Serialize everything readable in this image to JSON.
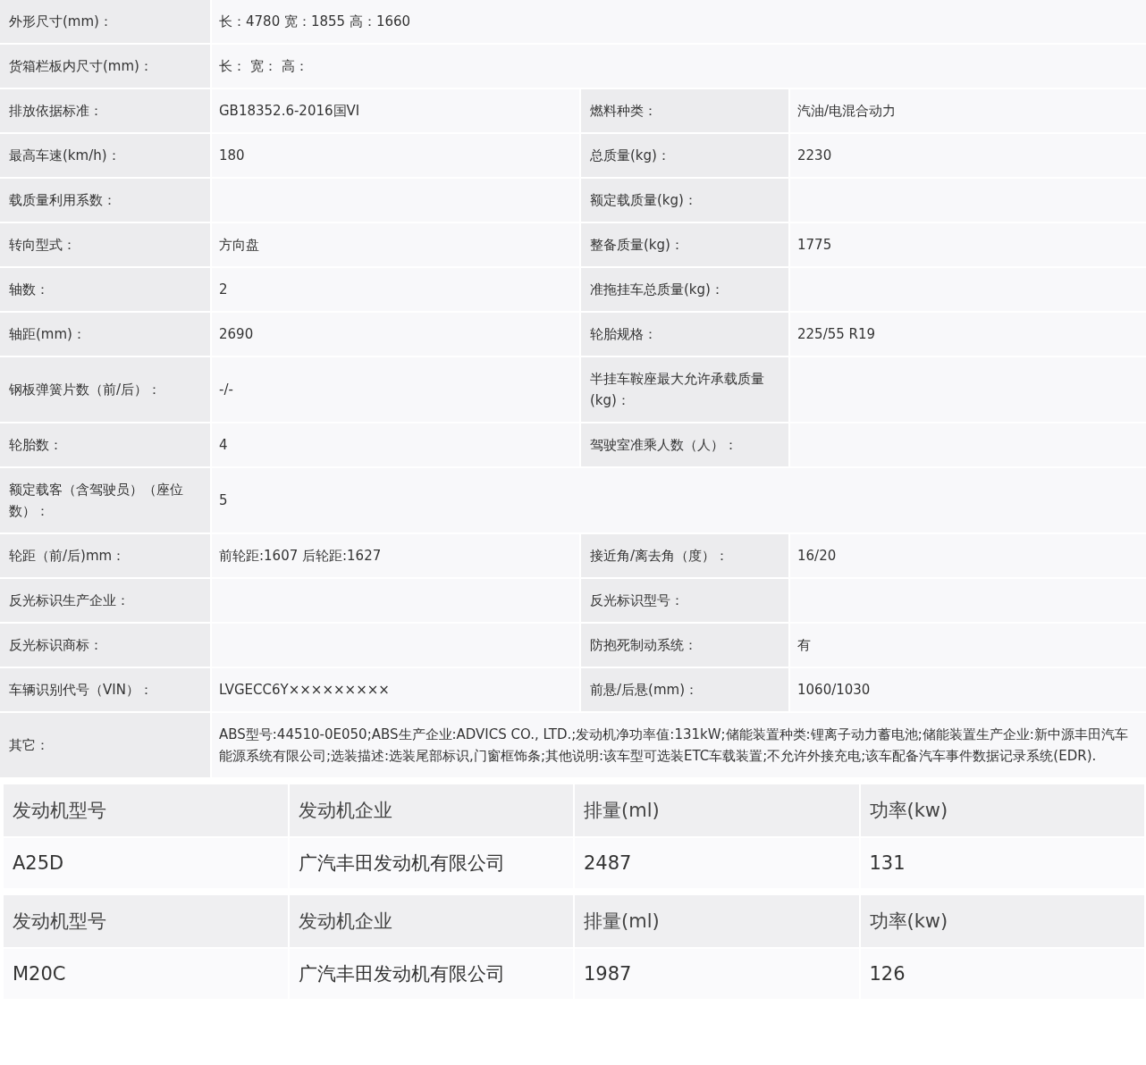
{
  "specs": [
    {
      "label": "外形尺寸(mm)：",
      "value": "长：4780 宽：1855 高：1660"
    },
    {
      "label": "货箱栏板内尺寸(mm)：",
      "value": "长：  宽：  高："
    },
    {
      "label": "排放依据标准：",
      "value": "GB18352.6-2016国VI",
      "label_2": "燃料种类：",
      "value_2": "汽油/电混合动力"
    },
    {
      "label": "最高车速(km/h)：",
      "value": "180",
      "label_2": "总质量(kg)：",
      "value_2": "2230"
    },
    {
      "label": "载质量利用系数：",
      "label_2": "额定载质量(kg)："
    },
    {
      "label": "转向型式：",
      "value": "方向盘",
      "label_2": "整备质量(kg)：",
      "value_2": "1775"
    },
    {
      "label": "轴数：",
      "value": "2",
      "label_2": "准拖挂车总质量(kg)："
    },
    {
      "label": "轴距(mm)：",
      "value": "2690",
      "label_2": "轮胎规格：",
      "value_2": "225/55 R19"
    },
    {
      "label": "钢板弹簧片数（前/后）：",
      "value": "-/-",
      "label_2": "半挂车鞍座最大允许承载质量(kg)："
    },
    {
      "label": "轮胎数：",
      "value": "4",
      "label_2": "驾驶室准乘人数（人）："
    },
    {
      "label": "额定载客（含驾驶员）（座位数）：",
      "value": "5"
    },
    {
      "label": "轮距（前/后)mm：",
      "value": "前轮距:1607 后轮距:1627",
      "label_2": "接近角/离去角（度）：",
      "value_2": "16/20"
    },
    {
      "label": "反光标识生产企业：",
      "label_2": "反光标识型号："
    },
    {
      "label": "反光标识商标：",
      "label_2": "防抱死制动系统：",
      "value_2": "有"
    },
    {
      "label": "车辆识别代号（VIN）：",
      "value": "LVGECC6Y×××××××××",
      "label_2": "前悬/后悬(mm)：",
      "value_2": "1060/1030"
    },
    {
      "label": "其它：",
      "value": "ABS型号:44510-0E050;ABS生产企业:ADVICS CO., LTD.;发动机净功率值:131kW;储能装置种类:锂离子动力蓄电池;储能装置生产企业:新中源丰田汽车能源系统有限公司;选装描述:选装尾部标识,门窗框饰条;其他说明:该车型可选装ETC车载装置;不允许外接充电;该车配备汽车事件数据记录系统(EDR)."
    }
  ],
  "engines": [
    {
      "columns": [
        "发动机型号",
        "发动机企业",
        "排量(ml)",
        "功率(kw)"
      ],
      "row": [
        "A25D",
        "广汽丰田发动机有限公司",
        "2487",
        "131"
      ]
    },
    {
      "columns": [
        "发动机型号",
        "发动机企业",
        "排量(ml)",
        "功率(kw)"
      ],
      "row": [
        "M20C",
        "广汽丰田发动机有限公司",
        "1987",
        "126"
      ]
    }
  ]
}
